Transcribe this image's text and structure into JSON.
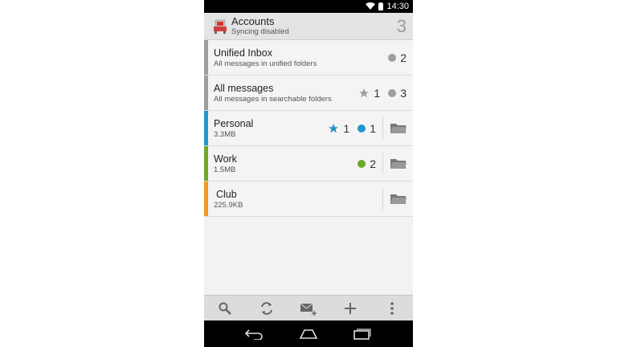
{
  "status_bar": {
    "time": "14:30",
    "wifi_icon": "wifi-icon",
    "battery_icon": "battery-icon"
  },
  "header": {
    "title": "Accounts",
    "subtitle": "Syncing disabled",
    "count": "3",
    "icon": "accounts-app-icon"
  },
  "rows": [
    {
      "name": "Unified Inbox",
      "desc": "All messages in unified folders",
      "stripe": "#9e9e9e",
      "starred": null,
      "unread": "2",
      "unread_color": "#9e9e9e",
      "folder": false
    },
    {
      "name": "All messages",
      "desc": "All messages in searchable folders",
      "stripe": "#9e9e9e",
      "starred": "1",
      "star_color": "#9e9e9e",
      "unread": "3",
      "unread_color": "#9e9e9e",
      "folder": false
    },
    {
      "name": "Personal",
      "desc": "3.3MB",
      "stripe": "#2196c8",
      "starred": "1",
      "star_color": "#2196c8",
      "unread": "1",
      "unread_color": "#2196c8",
      "folder": true
    },
    {
      "name": "Work",
      "desc": "1.5MB",
      "stripe": "#6fa82a",
      "starred": null,
      "unread": "2",
      "unread_color": "#6fa82a",
      "folder": true
    },
    {
      "name": "Club",
      "desc": "225.9KB",
      "stripe": "#f39a1e",
      "starred": null,
      "unread": null,
      "folder": true
    }
  ],
  "toolbar": {
    "items": [
      "search-icon",
      "refresh-icon",
      "compose-icon",
      "add-icon",
      "overflow-menu-icon"
    ]
  },
  "navigation": {
    "items": [
      "back-icon",
      "home-icon",
      "recents-icon"
    ]
  }
}
